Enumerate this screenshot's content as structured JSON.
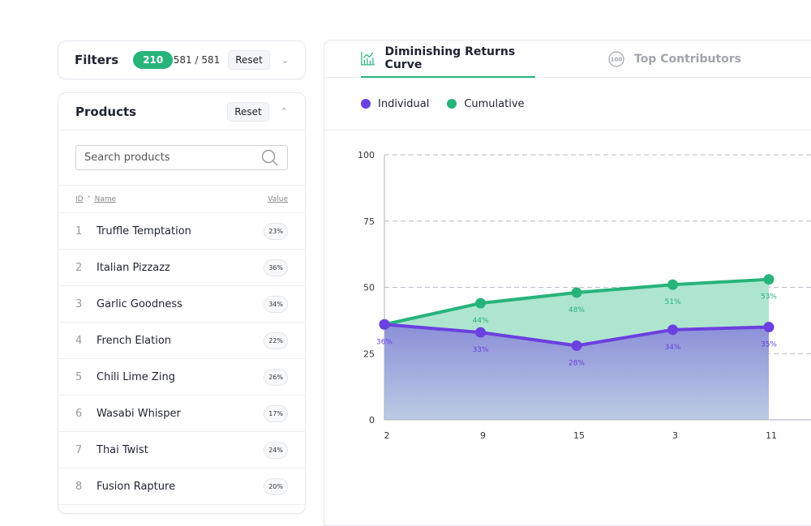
{
  "filters": {
    "title": "Filters",
    "badge": "210",
    "count": "581 / 581",
    "reset": "Reset"
  },
  "products": {
    "title": "Products",
    "reset": "Reset",
    "search_placeholder": "Search products",
    "columns": {
      "id": "ID",
      "name": "Name",
      "value": "Value"
    },
    "rows": [
      {
        "id": "1",
        "name": "Truffle Temptation",
        "value": "23%"
      },
      {
        "id": "2",
        "name": "Italian Pizzazz",
        "value": "36%"
      },
      {
        "id": "3",
        "name": "Garlic Goodness",
        "value": "34%"
      },
      {
        "id": "4",
        "name": "French Elation",
        "value": "22%"
      },
      {
        "id": "5",
        "name": "Chili Lime Zing",
        "value": "26%"
      },
      {
        "id": "6",
        "name": "Wasabi Whisper",
        "value": "17%"
      },
      {
        "id": "7",
        "name": "Thai Twist",
        "value": "24%"
      },
      {
        "id": "8",
        "name": "Fusion Rapture",
        "value": "20%"
      }
    ]
  },
  "tabs": [
    {
      "label": "Diminishing Returns Curve",
      "icon": "chart-icon",
      "active": true
    },
    {
      "label": "Top Contributors",
      "icon": "hundred-circle-icon",
      "active": false
    }
  ],
  "colors": {
    "individual": "#6c3fe0",
    "cumulative": "#27b47a"
  },
  "chart_data": {
    "type": "area",
    "categories": [
      "2",
      "9",
      "15",
      "3",
      "11"
    ],
    "ylim": [
      0,
      100
    ],
    "yticks": [
      0,
      25,
      50,
      75,
      100
    ],
    "grid": true,
    "legend": "top-left",
    "series": [
      {
        "name": "Individual",
        "values": [
          36,
          33,
          28,
          34,
          35
        ],
        "labels": [
          "36%",
          "33%",
          "28%",
          "34%",
          "35%"
        ]
      },
      {
        "name": "Cumulative",
        "values": [
          36,
          44,
          48,
          51,
          53
        ],
        "labels": [
          "",
          "44%",
          "48%",
          "51%",
          "53%"
        ]
      }
    ]
  }
}
